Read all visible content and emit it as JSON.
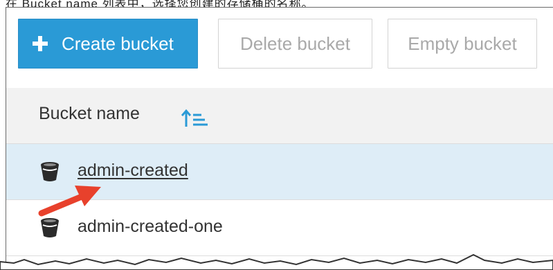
{
  "caption": {
    "text": "在 Bucket name 列表中，选择您创建的存储桶的名称。"
  },
  "toolbar": {
    "create_label": "Create bucket",
    "delete_label": "Delete bucket",
    "empty_label": "Empty bucket"
  },
  "table": {
    "column_header": "Bucket name",
    "sort_icon": "sort-ascending-icon",
    "rows": [
      {
        "name": "admin-created",
        "selected": true,
        "link": true,
        "icon": "bucket-icon"
      },
      {
        "name": "admin-created-one",
        "selected": false,
        "link": false,
        "icon": "bucket-icon"
      }
    ]
  },
  "annotation": {
    "arrow_color": "#e8412c"
  },
  "colors": {
    "accent": "#2a9ad6",
    "selected_row": "#deedf7",
    "header_bg": "#f2f2f2"
  }
}
